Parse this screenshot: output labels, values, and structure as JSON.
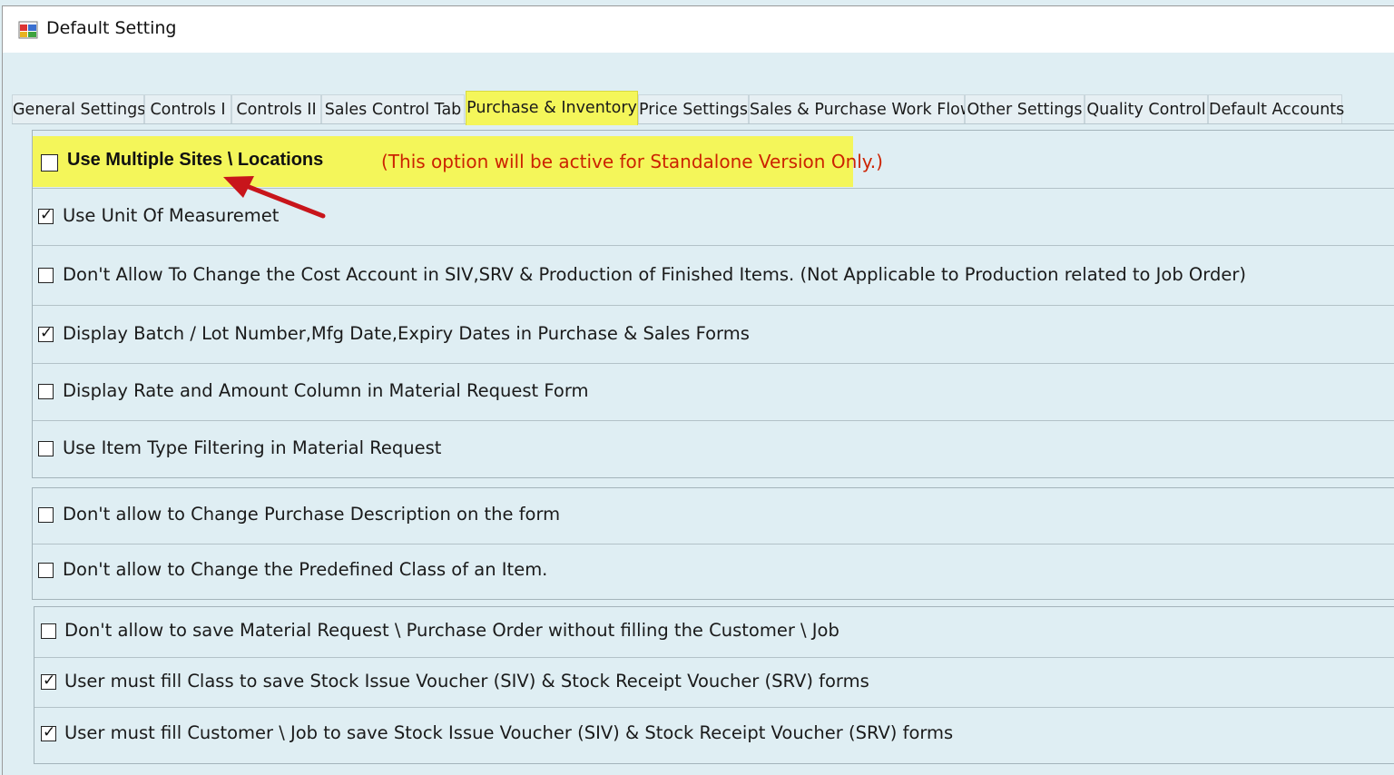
{
  "window": {
    "title": "Default Setting"
  },
  "tabs": [
    {
      "label": "General Settings",
      "active": false
    },
    {
      "label": "Controls I",
      "active": false
    },
    {
      "label": "Controls II",
      "active": false
    },
    {
      "label": "Sales Control Tab",
      "active": false
    },
    {
      "label": "Purchase & Inventory",
      "active": true
    },
    {
      "label": "Price Settings",
      "active": false
    },
    {
      "label": "Sales & Purchase Work Flow",
      "active": false
    },
    {
      "label": "Other Settings",
      "active": false
    },
    {
      "label": "Quality Control",
      "active": false
    },
    {
      "label": "Default Accounts",
      "active": false
    }
  ],
  "highlighted_option": {
    "label": "Use Multiple Sites \\ Locations",
    "checked": false,
    "note": "(This option will be active for Standalone Version Only.)"
  },
  "group1": [
    {
      "label": "Use Unit Of Measuremet",
      "checked": true
    },
    {
      "label": "Don't Allow To Change the Cost Account in SIV,SRV & Production of Finished Items. (Not Applicable to Production related to Job Order)",
      "checked": false
    },
    {
      "label": "Display Batch / Lot Number,Mfg Date,Expiry Dates in Purchase & Sales Forms",
      "checked": true
    },
    {
      "label": "Display Rate and Amount Column in Material Request Form",
      "checked": false
    },
    {
      "label": "Use Item Type Filtering in Material Request",
      "checked": false
    }
  ],
  "group2": [
    {
      "label": "Don't allow to Change Purchase Description  on the form",
      "checked": false
    },
    {
      "label": "Don't allow to Change the Predefined Class of an Item.",
      "checked": false
    }
  ],
  "group3": [
    {
      "label": "Don't allow to save Material Request \\ Purchase Order without filling the Customer \\ Job",
      "checked": false
    },
    {
      "label": "User must fill Class to save Stock Issue Voucher (SIV) & Stock Receipt Voucher (SRV) forms",
      "checked": true
    },
    {
      "label": "User must fill Customer \\ Job to save Stock Issue Voucher (SIV) & Stock Receipt Voucher (SRV) forms",
      "checked": true
    }
  ],
  "colors": {
    "highlight": "#f4f65a",
    "note_text": "#cc2200",
    "arrow": "#c8151b",
    "panel_bg": "#dfeef3"
  }
}
